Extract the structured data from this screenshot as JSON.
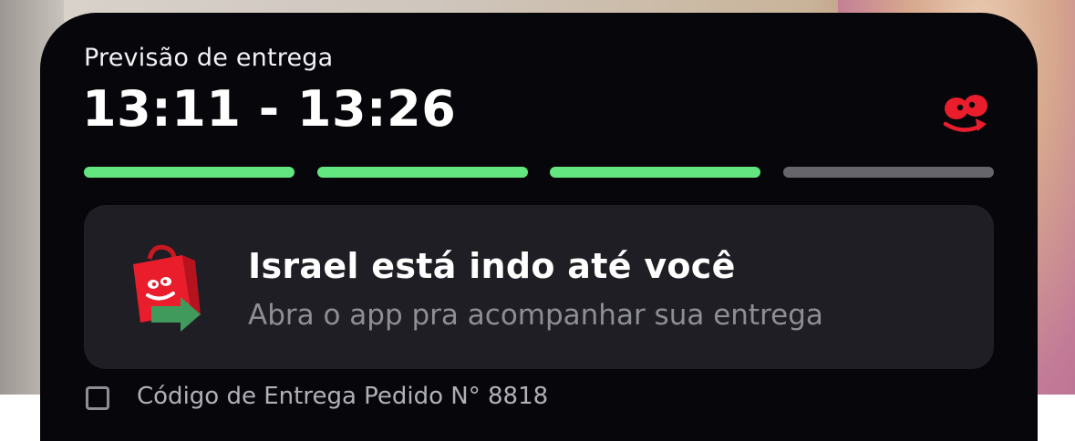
{
  "widget": {
    "eta_label": "Previsão de entrega",
    "eta_time": "13:11 - 13:26",
    "brand_icon": "ifood-logo-icon",
    "progress": {
      "total_steps": 4,
      "completed_steps": 3
    },
    "message_title": "Israel está indo até você",
    "message_subtitle": "Abra o app pra acompanhar sua entrega",
    "message_icon": "delivery-bag-icon",
    "footer_text": "Código de Entrega Pedido N° 8818"
  },
  "colors": {
    "card_background": "#07070b",
    "info_box_background": "#1e1e24",
    "progress_done": "#63e57f",
    "progress_pending": "#65656b",
    "brand_red": "#ea1d2c",
    "arrow_green": "#3f9a5c",
    "subtitle_gray": "#8e8e96"
  }
}
